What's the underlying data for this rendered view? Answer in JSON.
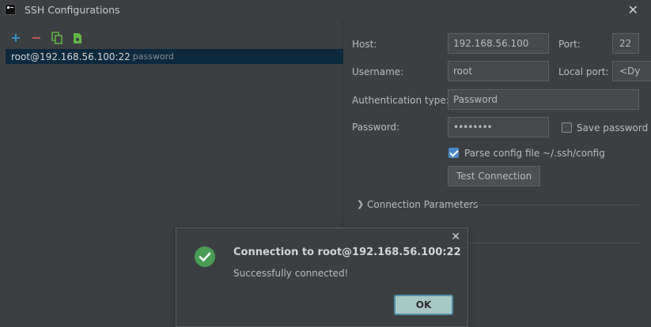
{
  "window": {
    "title": "SSH Configurations"
  },
  "toolbar": {
    "add_icon": "plus-icon",
    "remove_icon": "minus-icon",
    "copy_icon": "copy-icon",
    "import_icon": "import-config-icon",
    "colors": {
      "add": "#3592c4",
      "remove": "#c75450",
      "copy": "#62b543",
      "import": "#62b543"
    }
  },
  "configs": [
    {
      "name": "root@192.168.56.100:22",
      "auth": "password",
      "selected": true
    }
  ],
  "form": {
    "host_label": "Host:",
    "host_value": "192.168.56.100",
    "port_label": "Port:",
    "port_value": "22",
    "username_label": "Username:",
    "username_value": "root",
    "local_port_label": "Local port:",
    "local_port_value": "<Dy",
    "auth_type_label": "Authentication type:",
    "auth_type_value": "Password",
    "password_label": "Password:",
    "password_value": "••••••••",
    "save_password_label": "Save password",
    "save_password_checked": false,
    "parse_config_label": "Parse config file ~/.ssh/config",
    "parse_config_checked": true,
    "test_connection_label": "Test Connection",
    "connection_params_label": "Connection Parameters"
  },
  "dialog": {
    "title": "Connection to root@192.168.56.100:22",
    "message": "Successfully connected!",
    "ok_label": "OK",
    "icon": "success-check-icon",
    "icon_color": "#499c54"
  }
}
